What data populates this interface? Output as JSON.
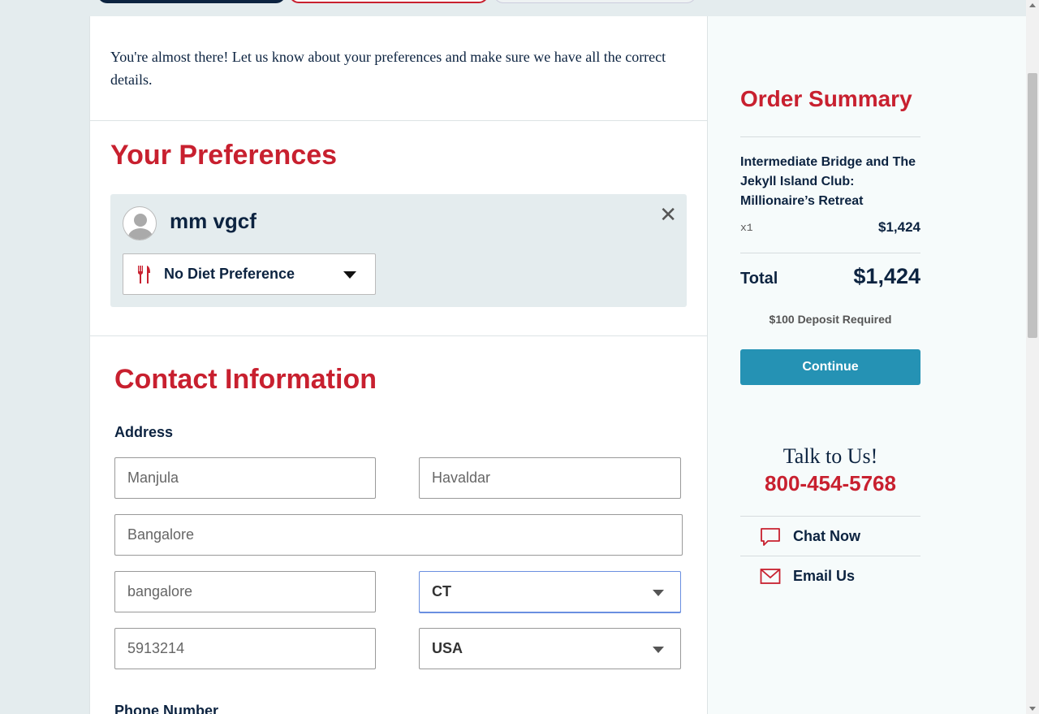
{
  "intro_text": "You're almost there! Let us know about your preferences and make sure we have all the correct details.",
  "preferences": {
    "title": "Your Preferences",
    "traveler_name": "mm vgcf",
    "diet_selected": "No Diet Preference"
  },
  "contact": {
    "title": "Contact Information",
    "address_label": "Address",
    "first_name": "Manjula",
    "last_name": "Havaldar",
    "street": "Bangalore",
    "city": "bangalore",
    "state": "CT",
    "zip": "5913214",
    "country": "USA",
    "phone_label": "Phone Number"
  },
  "order_summary": {
    "title": "Order Summary",
    "product": "Intermediate Bridge and The Jekyll Island Club: Millionaire’s Retreat",
    "quantity": "x1",
    "price": "$1,424",
    "total_label": "Total",
    "total_value": "$1,424",
    "deposit": "$100 Deposit Required",
    "continue_label": "Continue"
  },
  "help": {
    "talk": "Talk to Us!",
    "phone": "800-454-5768",
    "chat": "Chat Now",
    "email": "Email Us"
  },
  "colors": {
    "accent_red": "#c8202f",
    "navy": "#0c2340",
    "button_teal": "#2592b4"
  }
}
